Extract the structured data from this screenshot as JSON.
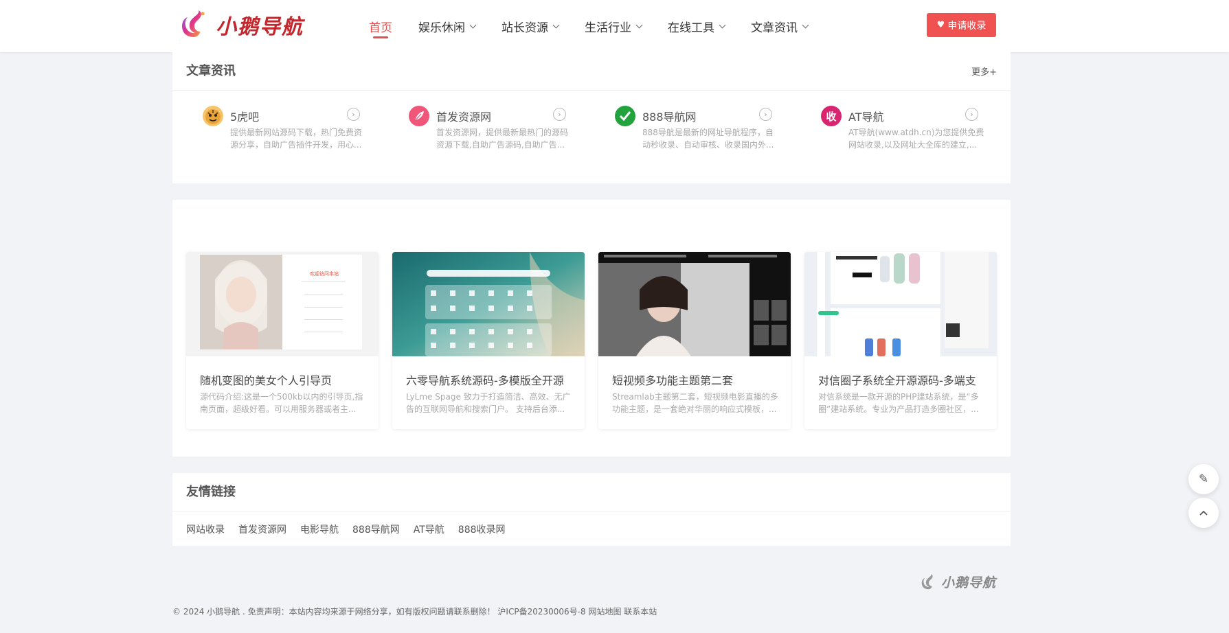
{
  "header": {
    "logo_text": "小鹅导航",
    "nav": [
      {
        "label": "首页",
        "active": true,
        "has_dropdown": false
      },
      {
        "label": "娱乐休闲",
        "has_dropdown": true
      },
      {
        "label": "站长资源",
        "has_dropdown": true
      },
      {
        "label": "生活行业",
        "has_dropdown": true
      },
      {
        "label": "在线工具",
        "has_dropdown": true
      },
      {
        "label": "文章资讯",
        "has_dropdown": true
      }
    ],
    "apply_button": "申请收录"
  },
  "articles_section": {
    "title": "文章资讯",
    "more": "更多+",
    "sites": [
      {
        "name": "5虎吧",
        "desc": "提供最新网站源码下载，热门免费资源分享，自助广告插件开发，用心...",
        "icon": "tiger-icon",
        "color": "#e8a33a"
      },
      {
        "name": "首发资源网",
        "desc": "首发资源网，提供最新最热门的源码资源下载,自助广告源码,自助广告...",
        "icon": "feather-icon",
        "color": "#f0567a"
      },
      {
        "name": "888导航网",
        "desc": "888导航是最新的网址导航程序，自动秒收录、自动审核、收录国内外...",
        "icon": "checkmark-icon",
        "color": "#23a33e"
      },
      {
        "name": "AT导航",
        "desc": "AT导航(www.atdh.cn)为您提供免费网站收录,以及网址大全库的建立,...",
        "icon": "shou-icon",
        "color": "#d9256f",
        "glyph": "收"
      }
    ]
  },
  "featured_section": {
    "cards": [
      {
        "title": "随机变图的美女个人引导页",
        "desc": "源代码介绍:这是一个500kb以内的引导页,指南页面，超级好看。可以用服务器或者主...",
        "thumb": "portrait"
      },
      {
        "title": "六零导航系统源码-多模版全开源",
        "desc": "LyLme Spage 致力于打造简洁、高效、无广告的互联网导航和搜索门户。 支持后台添...",
        "thumb": "ocean"
      },
      {
        "title": "短视频多功能主题第二套",
        "desc": "Streamlab主题第二套，短视频电影直播的多功能主题，是一套绝对华丽的响应式模板，...",
        "thumb": "video"
      },
      {
        "title": "对信圈子系统全开源源码-多端支",
        "desc": "对信系统是一款开源的PHP建站系统，是“多圈”建站系统。专业为产品打造多圈社区，...",
        "thumb": "app"
      }
    ]
  },
  "friends_section": {
    "title": "友情链接",
    "links": [
      "网站收录",
      "首发资源网",
      "电影导航",
      "888导航网",
      "AT导航",
      "888收录网"
    ]
  },
  "footer": {
    "logo_text": "小鹅导航",
    "copyright": "© 2024 小鹅导航 . 免责声明：本站内容均来源于网络分享，如有版权问题请联系删除！  沪ICP备20230006号-8 网站地图 联系本站"
  },
  "float_buttons": {
    "edit": "pencil-icon",
    "top": "chevron-up-icon"
  }
}
